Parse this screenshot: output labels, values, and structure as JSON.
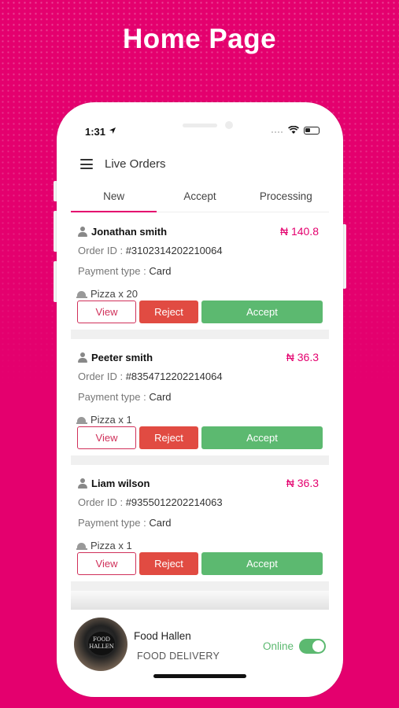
{
  "hero": {
    "title": "Home Page"
  },
  "status_bar": {
    "time": "1:31"
  },
  "appbar": {
    "title": "Live Orders"
  },
  "tabs": [
    {
      "label": "New",
      "active": true
    },
    {
      "label": "Accept",
      "active": false
    },
    {
      "label": "Processing",
      "active": false
    }
  ],
  "orders": [
    {
      "customer": "Jonathan smith",
      "price": "₦ 140.8",
      "order_id_label": "Order ID : ",
      "order_id": "#3102314202210064",
      "payment_label": "Payment type : ",
      "payment": "Card",
      "item": "Pizza x 20",
      "view_label": "View",
      "reject_label": "Reject",
      "accept_label": "Accept"
    },
    {
      "customer": "Peeter smith",
      "price": "₦ 36.3",
      "order_id_label": "Order ID : ",
      "order_id": "#8354712202214064",
      "payment_label": "Payment type : ",
      "payment": "Card",
      "item": "Pizza x 1",
      "view_label": "View",
      "reject_label": "Reject",
      "accept_label": "Accept"
    },
    {
      "customer": "Liam wilson",
      "price": "₦ 36.3",
      "order_id_label": "Order ID : ",
      "order_id": "#9355012202214063",
      "payment_label": "Payment type : ",
      "payment": "Card",
      "item": "Pizza x 1",
      "view_label": "View",
      "reject_label": "Reject",
      "accept_label": "Accept"
    }
  ],
  "footer": {
    "store_name": "Food Hallen",
    "store_subtitle": "FOOD DELIVERY",
    "status_label": "Online",
    "online": true,
    "logo_text": "FOOD HALLEN"
  },
  "colors": {
    "brand": "#e4006e",
    "accept": "#5cb970",
    "reject": "#e14b42",
    "view_border": "#d0305a"
  }
}
